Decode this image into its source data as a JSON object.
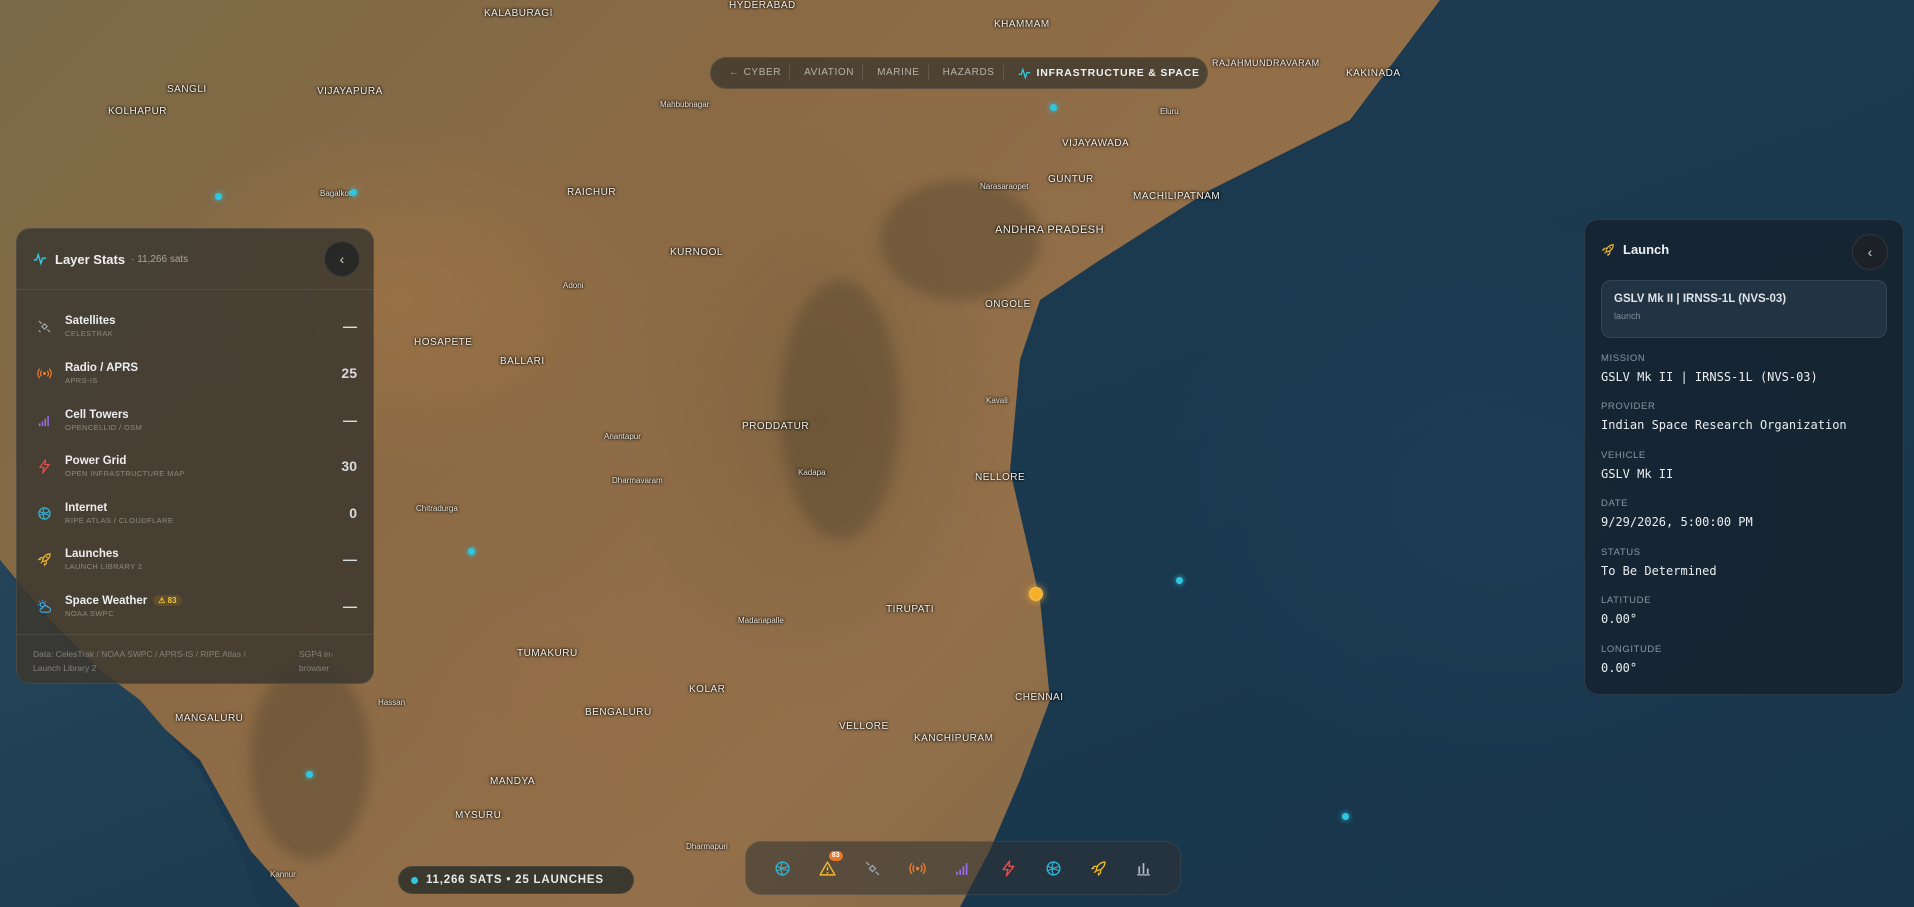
{
  "tabs": [
    {
      "label": "CYBER"
    },
    {
      "label": "AVIATION"
    },
    {
      "label": "MARINE"
    },
    {
      "label": "HAZARDS"
    },
    {
      "label": "INFRASTRUCTURE & SPACE",
      "active": true
    }
  ],
  "map_labels": [
    "HYDERABAD",
    "KHAMMAM",
    "RAJAHMUNDRAVARAM",
    "KAKINADA",
    "KALABURAGI",
    "VIJAYAPURA",
    "SANGLI",
    "KOLHAPUR",
    "Mahbubnagar",
    "Bagalkot",
    "RAICHUR",
    "Eluru",
    "VIJAYAWADA",
    "GUNTUR",
    "Narasaraopet",
    "MACHILIPATNAM",
    "KURNOOL",
    "Adoni",
    "ANDHRA PRADESH",
    "ONGOLE",
    "HOSAPETE",
    "BALLARI",
    "PRODDATUR",
    "Kavali",
    "Anantapur",
    "NELLORE",
    "Kadapa",
    "Dharmavaram",
    "Chitradurga",
    "TIRUPATI",
    "Madanapalle",
    "TUMAKURU",
    "KOLAR",
    "CHENNAI",
    "Hassan",
    "BENGALURU",
    "VELLORE",
    "KANCHIPURAM",
    "MANGALURU",
    "MANDYA",
    "MYSURU",
    "Dharmapuri",
    "Kannur"
  ],
  "layer_stats": {
    "title": "Layer Stats",
    "subtitle": "· 11,266 sats",
    "collapse_glyph": "‹",
    "items": [
      {
        "name": "Satellites",
        "source": "CELESTRAK",
        "value": "—",
        "icon": "satellite-icon",
        "color": "#9aa3ad"
      },
      {
        "name": "Radio / APRS",
        "source": "APRS-IS",
        "value": "25",
        "icon": "radio-icon",
        "color": "#ef7d2e"
      },
      {
        "name": "Cell Towers",
        "source": "OPENCELLID / OSM",
        "value": "—",
        "icon": "signal-bars-icon",
        "color": "#9b6df2"
      },
      {
        "name": "Power Grid",
        "source": "OPEN INFRASTRUCTURE MAP",
        "value": "30",
        "icon": "lightning-icon",
        "color": "#ef4b4b"
      },
      {
        "name": "Internet",
        "source": "RIPE ATLAS / CLOUDFLARE",
        "value": "0",
        "icon": "globe-icon",
        "color": "#2fb5d8"
      },
      {
        "name": "Launches",
        "source": "LAUNCH LIBRARY 2",
        "value": "—",
        "icon": "rocket-icon",
        "color": "#f1b92a"
      },
      {
        "name": "Space Weather",
        "source": "NOAA SWPC",
        "value": "—",
        "icon": "sun-cloud-icon",
        "color": "#3fa9e8",
        "badge": "⚠ 83"
      }
    ],
    "footer_sources": "Data: CelesTrak / NOAA SWPC / APRS-IS / RIPE Atlas / Launch Library 2",
    "footer_note": "SGP4 in-browser"
  },
  "launch_panel": {
    "title": "Launch",
    "collapse_glyph": "‹",
    "card_title": "GSLV Mk II | IRNSS-1L (NVS-03)",
    "card_sub": "launch",
    "fields": [
      {
        "key": "MISSION",
        "value": "GSLV Mk II | IRNSS-1L (NVS-03)"
      },
      {
        "key": "PROVIDER",
        "value": "Indian Space Research Organization"
      },
      {
        "key": "VEHICLE",
        "value": "GSLV Mk II"
      },
      {
        "key": "DATE",
        "value": "9/29/2026, 5:00:00 PM"
      },
      {
        "key": "STATUS",
        "value": "To Be Determined"
      },
      {
        "key": "LATITUDE",
        "value": "0.00°"
      },
      {
        "key": "LONGITUDE",
        "value": "0.00°"
      }
    ]
  },
  "status_bar": {
    "text": "11,266 SATS • 25 LAUNCHES"
  },
  "toolbar": {
    "buttons": [
      {
        "icon": "globe-icon",
        "color": "#2fb5d8"
      },
      {
        "icon": "warning-icon",
        "color": "#f1b92a",
        "badge": "83"
      },
      {
        "icon": "satellite-icon",
        "color": "#9aa3ad"
      },
      {
        "icon": "radio-icon",
        "color": "#ef7d2e"
      },
      {
        "icon": "signal-bars-icon",
        "color": "#9b6df2"
      },
      {
        "icon": "lightning-icon",
        "color": "#ef4b4b"
      },
      {
        "icon": "globe-icon",
        "color": "#2fb5d8"
      },
      {
        "icon": "rocket-icon",
        "color": "#f1b92a"
      },
      {
        "icon": "bar-chart-icon",
        "color": "#b6bcc4"
      }
    ]
  }
}
